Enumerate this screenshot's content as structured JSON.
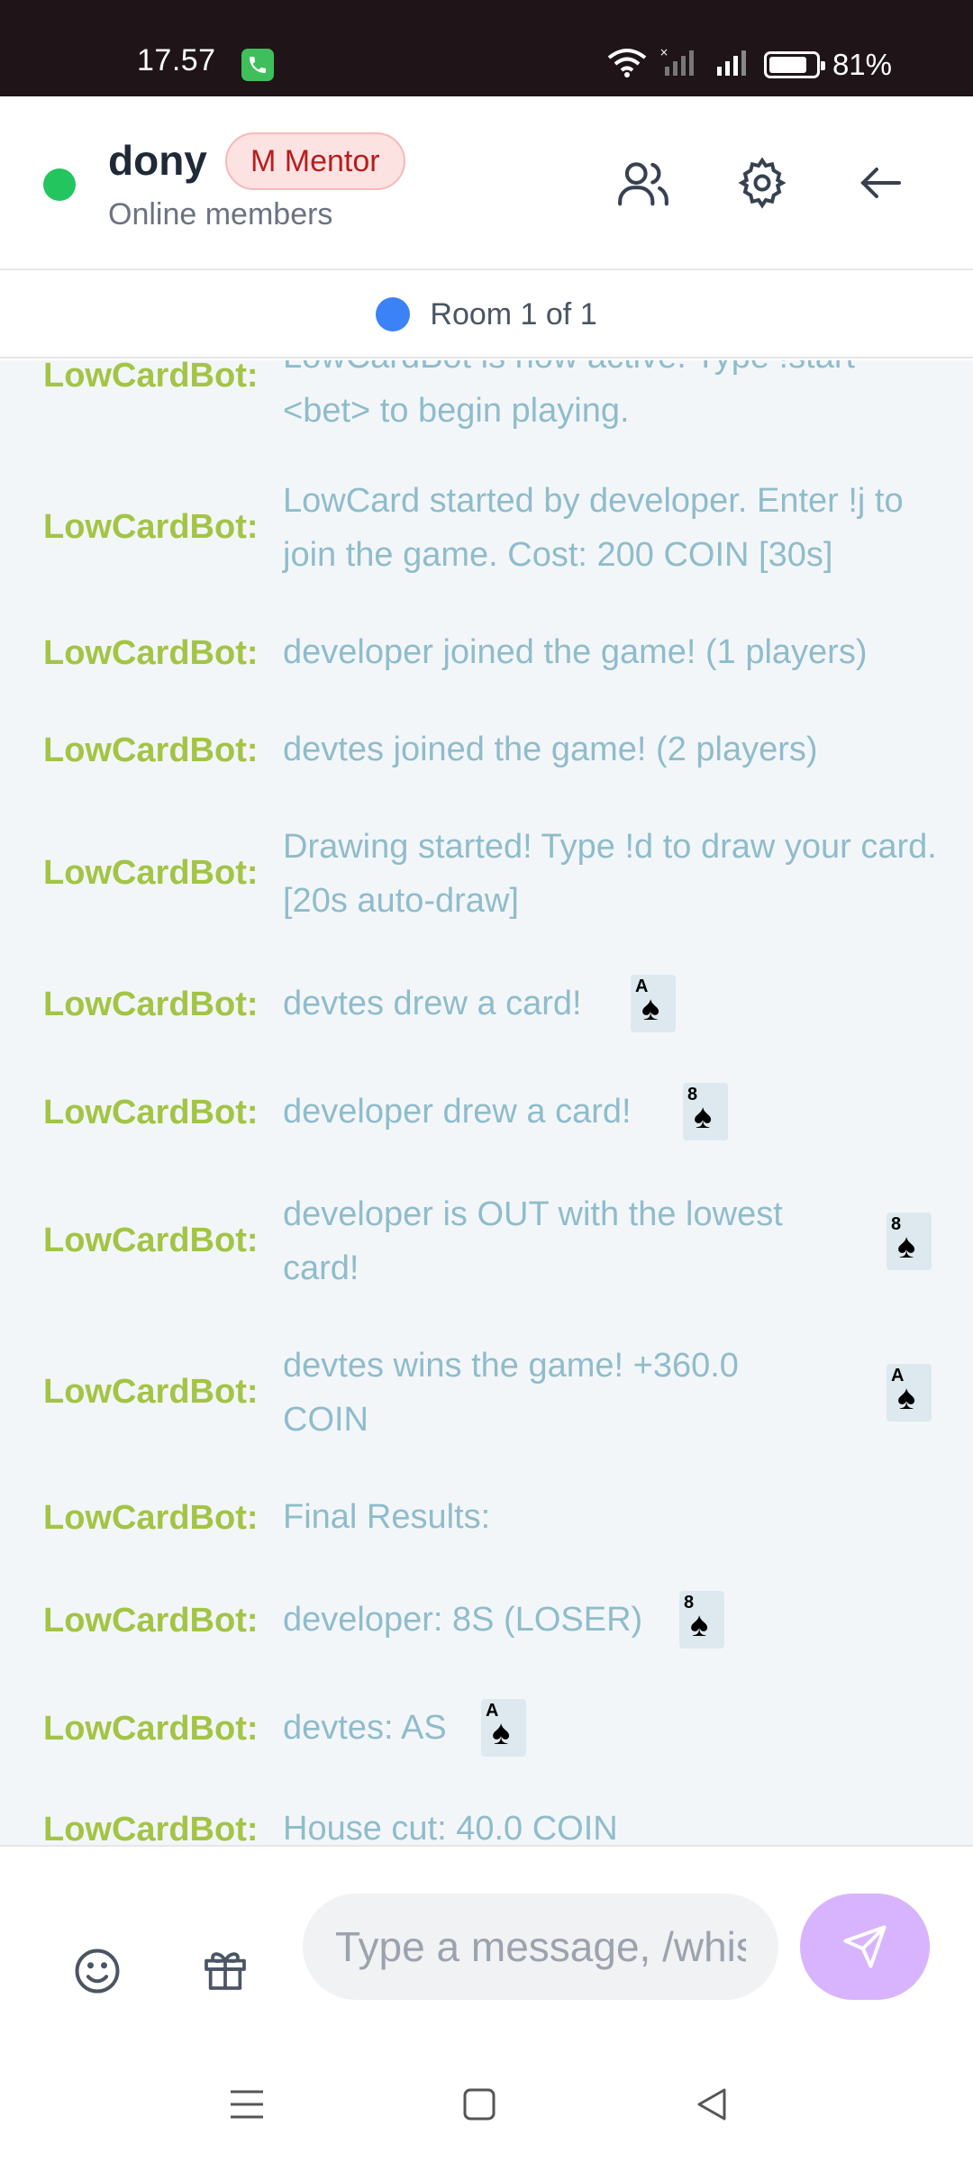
{
  "status_bar": {
    "time": "17.57",
    "battery": "81%",
    "battery_level": 0.81
  },
  "header": {
    "room_name": "dony",
    "badge": "M Mentor",
    "subtitle": "Online members",
    "icons": [
      "members-icon",
      "gear-icon",
      "back-arrow-icon"
    ]
  },
  "room_bar": {
    "label": "Room 1 of 1",
    "dot_color": "#3b82f6"
  },
  "colors": {
    "sender": "#a3c444",
    "message": "#8fbccb",
    "accent": "#d8b4fe",
    "online": "#22c55e"
  },
  "messages": [
    {
      "sender": "LowCardBot:",
      "text": "LowCardBot is now active. Type !start <bet> to begin playing."
    },
    {
      "sender": "LowCardBot:",
      "text": "LowCard started by developer. Enter !j to join the game. Cost: 200 COIN [30s]"
    },
    {
      "sender": "LowCardBot:",
      "text": "developer joined the game! (1 players)"
    },
    {
      "sender": "LowCardBot:",
      "text": "devtes joined the game! (2 players)"
    },
    {
      "sender": "LowCardBot:",
      "text": "Drawing started! Type !d to draw your card. [20s auto-draw]"
    },
    {
      "sender": "LowCardBot:",
      "text": "devtes drew a card!",
      "card": {
        "rank": "A",
        "suit": "♠"
      }
    },
    {
      "sender": "LowCardBot:",
      "text": "developer drew a card!",
      "card": {
        "rank": "8",
        "suit": "♠"
      }
    },
    {
      "sender": "LowCardBot:",
      "text": "developer is OUT with the lowest card!",
      "card": {
        "rank": "8",
        "suit": "♠"
      }
    },
    {
      "sender": "LowCardBot:",
      "text": "devtes wins the game! +360.0 COIN",
      "card": {
        "rank": "A",
        "suit": "♠"
      }
    },
    {
      "sender": "LowCardBot:",
      "text": "Final Results:"
    },
    {
      "sender": "LowCardBot:",
      "text": "developer: 8S (LOSER)",
      "card": {
        "rank": "8",
        "suit": "♠"
      }
    },
    {
      "sender": "LowCardBot:",
      "text": "devtes: AS",
      "card": {
        "rank": "A",
        "suit": "♠"
      }
    },
    {
      "sender": "LowCardBot:",
      "text": "House cut: 40.0 COIN"
    }
  ],
  "composer": {
    "placeholder": "Type a message, /whisper..."
  }
}
